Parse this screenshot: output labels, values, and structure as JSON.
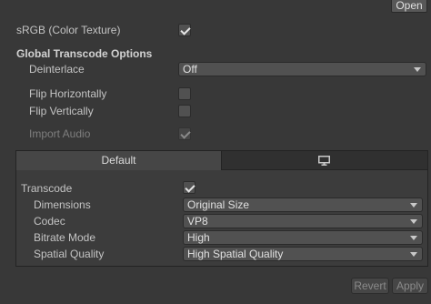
{
  "header": {
    "open_label": "Open"
  },
  "srgb": {
    "label": "sRGB (Color Texture)",
    "checked": true
  },
  "global_transcode": {
    "title": "Global Transcode Options",
    "deinterlace": {
      "label": "Deinterlace",
      "value": "Off"
    },
    "flip_horizontally": {
      "label": "Flip Horizontally",
      "checked": false
    },
    "flip_vertically": {
      "label": "Flip Vertically",
      "checked": false
    },
    "import_audio": {
      "label": "Import Audio",
      "checked": true,
      "disabled": true
    }
  },
  "platform_tabs": [
    {
      "label": "Default",
      "active": true
    },
    {
      "icon": "monitor-icon",
      "active": false
    }
  ],
  "platform_settings": {
    "transcode": {
      "label": "Transcode",
      "checked": true
    },
    "dimensions": {
      "label": "Dimensions",
      "value": "Original Size"
    },
    "codec": {
      "label": "Codec",
      "value": "VP8"
    },
    "bitrate_mode": {
      "label": "Bitrate Mode",
      "value": "High"
    },
    "spatial_quality": {
      "label": "Spatial Quality",
      "value": "High Spatial Quality"
    }
  },
  "footer": {
    "revert_label": "Revert",
    "apply_label": "Apply"
  },
  "colors": {
    "background": "#383838",
    "panel": "#3c3c3c",
    "field": "#515151",
    "text": "#c4c4c4"
  }
}
